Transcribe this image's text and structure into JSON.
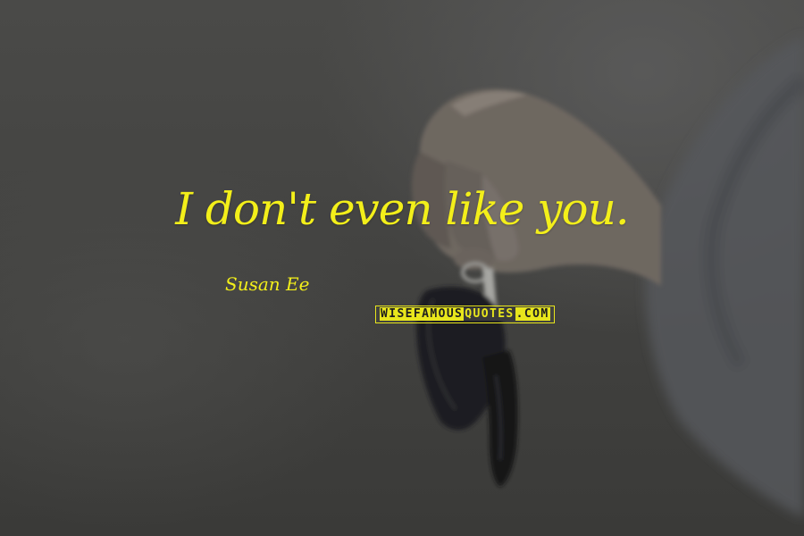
{
  "image": {
    "background_color": "#444442",
    "text_color": "#f3ef1a",
    "subjects": [
      "hand-icon",
      "car-key-icon"
    ]
  },
  "quote": {
    "text": "I don't even like you.",
    "author": "Susan Ee"
  },
  "watermark": {
    "part1": "WISEFAMOUS",
    "part2": "QUOTES",
    "part3": ".COM"
  }
}
